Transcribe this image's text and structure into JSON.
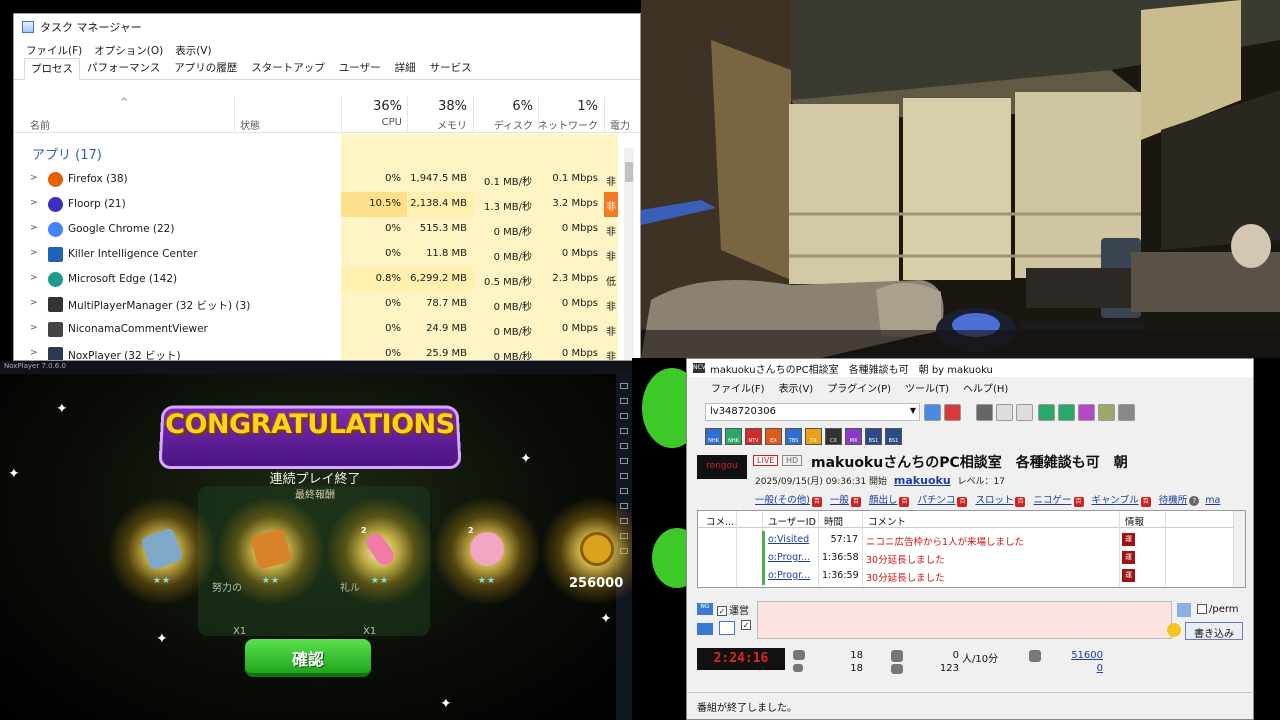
{
  "task_manager": {
    "title": "タスク マネージャー",
    "menu": [
      "ファイル(F)",
      "オプション(O)",
      "表示(V)"
    ],
    "tabs": [
      "プロセス",
      "パフォーマンス",
      "アプリの履歴",
      "スタートアップ",
      "ユーザー",
      "詳細",
      "サービス"
    ],
    "active_tab": "プロセス",
    "columns": {
      "name": "名前",
      "status": "状態",
      "cpu": {
        "pct": "36%",
        "label": "CPU"
      },
      "memory": {
        "pct": "38%",
        "label": "メモリ"
      },
      "disk": {
        "pct": "6%",
        "label": "ディスク"
      },
      "network": {
        "pct": "1%",
        "label": "ネットワーク"
      },
      "power": {
        "label": "電力"
      }
    },
    "group_label": "アプリ (17)",
    "rows": [
      {
        "name": "Firefox (38)",
        "cpu": "0%",
        "memory": "1,947.5 MB",
        "disk": "0.1 MB/秒",
        "network": "0.1 Mbps",
        "power": "非",
        "icon": "firefox-icon"
      },
      {
        "name": "Floorp (21)",
        "cpu": "10.5%",
        "memory": "2,138.4 MB",
        "disk": "1.3 MB/秒",
        "network": "3.2 Mbps",
        "power": "非",
        "icon": "floorp-icon"
      },
      {
        "name": "Google Chrome (22)",
        "cpu": "0%",
        "memory": "515.3 MB",
        "disk": "0 MB/秒",
        "network": "0 Mbps",
        "power": "非",
        "icon": "chrome-icon"
      },
      {
        "name": "Killer Intelligence Center",
        "cpu": "0%",
        "memory": "11.8 MB",
        "disk": "0 MB/秒",
        "network": "0 Mbps",
        "power": "非",
        "icon": "killer-icon"
      },
      {
        "name": "Microsoft Edge (142)",
        "cpu": "0.8%",
        "memory": "6,299.2 MB",
        "disk": "0.5 MB/秒",
        "network": "2.3 Mbps",
        "power": "低",
        "icon": "edge-icon"
      },
      {
        "name": "MultiPlayerManager (32 ビット) (3)",
        "cpu": "0%",
        "memory": "78.7 MB",
        "disk": "0 MB/秒",
        "network": "0 Mbps",
        "power": "非",
        "icon": "multiplayer-icon"
      },
      {
        "name": "NiconamaCommentViewer",
        "cpu": "0%",
        "memory": "24.9 MB",
        "disk": "0 MB/秒",
        "network": "0 Mbps",
        "power": "非",
        "icon": "ncv-icon"
      },
      {
        "name": "NoxPlayer (32 ビット)",
        "cpu": "0%",
        "memory": "25.9 MB",
        "disk": "0 MB/秒",
        "network": "0 Mbps",
        "power": "非",
        "icon": "nox-icon"
      }
    ],
    "colors": {
      "heat_light": "#fff4c4",
      "heat_mid": "#ffe79a",
      "heat_hot": "#f47b20",
      "group_blue": "#2a5fb0"
    }
  },
  "nox": {
    "window_title": "NoxPlayer 7.0.6.0",
    "banner": "CONGRATULATIONS",
    "title": "連続プレイ終了",
    "subtitle": "最終報酬",
    "hidden_label_1": "努力の",
    "hidden_label_2": "礼ル",
    "multiplier": "X1",
    "rewards": [
      {
        "qty": "",
        "stars": "★★",
        "color": "#7fa8c8",
        "icon": "gem-box-icon"
      },
      {
        "qty": "",
        "stars": "★★",
        "color": "#d8822a",
        "icon": "book-icon"
      },
      {
        "qty": "2",
        "stars": "★★",
        "color": "#f07aa8",
        "icon": "potion-icon"
      },
      {
        "qty": "2",
        "stars": "★★",
        "color": "#f1a6c4",
        "icon": "flower-icon"
      }
    ],
    "coin_amount": "256000",
    "confirm_label": "確認"
  },
  "ncv": {
    "window_title": "makuokuさんちのPC相談室　各種雑談も可　朝 by makuoku",
    "menu": [
      "ファイル(F)",
      "表示(V)",
      "プラグイン(P)",
      "ツール(T)",
      "ヘルプ(H)"
    ],
    "live_id": "lv348720306",
    "channels": [
      "NHK",
      "NHK",
      "NTV",
      "EX",
      "TBS",
      "TX",
      "CX",
      "MX",
      "BS1",
      "BS1"
    ],
    "badge_live": "LIVE",
    "badge_hd": "HD",
    "live_title": "makuokuさんちのPC相談室　各種雑談も可　朝",
    "start_time": "2025/09/15(月) 09:36:31 開始",
    "owner": "makuoku",
    "level": "レベル：17",
    "tags": [
      "一般(その他)",
      "一般",
      "顔出し",
      "パチンコ",
      "スロット",
      "ニコゲー",
      "ギャンブル",
      "待機所",
      "ma"
    ],
    "grid_headers": [
      "コメ...",
      "ユーザーID",
      "時間",
      "コメント",
      "情報"
    ],
    "comments": [
      {
        "uid": "o:Visited",
        "time": "57:17",
        "text": "ニコニ広告枠から1人が来場しました",
        "flag": "運"
      },
      {
        "uid": "o:Progr...",
        "time": "1:36:58",
        "text": "30分延長しました",
        "flag": "運"
      },
      {
        "uid": "o:Progr...",
        "time": "1:36:59",
        "text": "30分延長しました",
        "flag": "運"
      }
    ],
    "operator_label": "運営",
    "perm_label": "/perm",
    "write_label": "書き込み",
    "timer": "2:24:16",
    "stats": {
      "a1": "18",
      "a2": "18",
      "b1": "0",
      "b1_unit": "人/10分",
      "b2": "123",
      "c1": "51600",
      "c2": "0"
    },
    "status": "番組が終了しました。",
    "logo_text": "rengou"
  }
}
